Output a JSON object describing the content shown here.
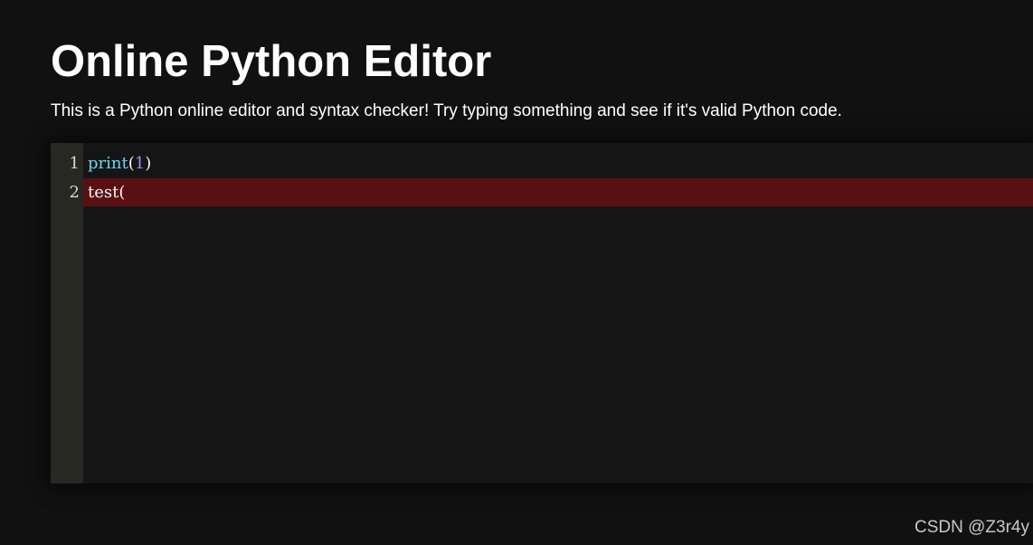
{
  "header": {
    "title": "Online Python Editor",
    "description": "This is a Python online editor and syntax checker! Try typing something and see if it's valid Python code."
  },
  "editor": {
    "line_numbers": [
      "1",
      "2"
    ],
    "lines": [
      {
        "tokens": [
          {
            "type": "func",
            "text": "print"
          },
          {
            "type": "punc",
            "text": "("
          },
          {
            "type": "num",
            "text": "1"
          },
          {
            "type": "punc",
            "text": ")"
          }
        ],
        "error": false
      },
      {
        "tokens": [
          {
            "type": "plain",
            "text": "test("
          }
        ],
        "error": true
      }
    ],
    "colors": {
      "background": "#151515",
      "gutter": "#272822",
      "error_line": "#5a1012",
      "function": "#66d9ef",
      "number": "#ae81ff",
      "text": "#f8f8f2"
    }
  },
  "watermark": {
    "text": "CSDN @Z3r4y"
  }
}
